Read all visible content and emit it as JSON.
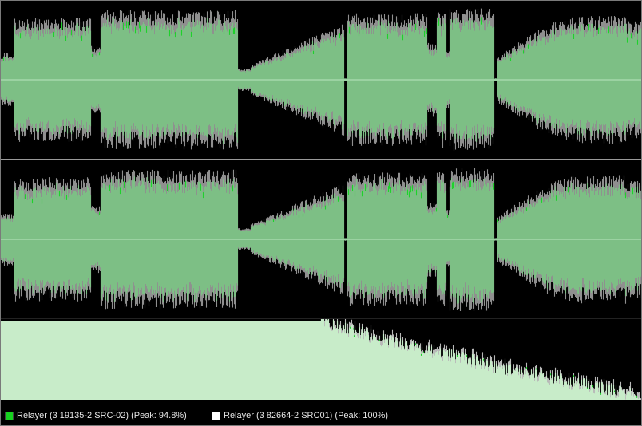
{
  "colors": {
    "background": "#000000",
    "wave_primary": "#7dbf85",
    "wave_secondary": "#8f8f8f",
    "wave_highlight": "#1fd12c",
    "center_line": "#b9e6bf",
    "spectrum_primary": "#c8ecc9",
    "spectrum_secondary": "#b8b8b8",
    "separator": "#9a9a9a"
  },
  "legend": {
    "items": [
      {
        "swatch_color": "#16d11f",
        "label": "Relayer (3 19135-2 SRC-02) (Peak: 94.8%)"
      },
      {
        "swatch_color": "#ffffff",
        "label": "Relayer (3 82664-2 SRC01) (Peak: 100%)"
      }
    ]
  },
  "waveform": {
    "envelope_levels": [
      {
        "from": 0.0,
        "to": 0.02,
        "level": 0.35
      },
      {
        "from": 0.02,
        "to": 0.14,
        "level": 0.82
      },
      {
        "from": 0.14,
        "to": 0.155,
        "level": 0.45
      },
      {
        "from": 0.155,
        "to": 0.37,
        "level": 0.92
      },
      {
        "from": 0.37,
        "to": 0.39,
        "level": 0.15
      },
      {
        "from": 0.39,
        "to": 0.535,
        "level": 0.55,
        "rising": true
      },
      {
        "from": 0.535,
        "to": 0.54,
        "level": 0.02
      },
      {
        "from": 0.54,
        "to": 0.665,
        "level": 0.88
      },
      {
        "from": 0.665,
        "to": 0.68,
        "level": 0.5
      },
      {
        "from": 0.68,
        "to": 0.695,
        "level": 0.9
      },
      {
        "from": 0.695,
        "to": 0.7,
        "level": 0.4
      },
      {
        "from": 0.7,
        "to": 0.77,
        "level": 0.95
      },
      {
        "from": 0.77,
        "to": 0.775,
        "level": 0.02
      },
      {
        "from": 0.775,
        "to": 1.0,
        "level": 0.85,
        "swell": true
      }
    ]
  },
  "spectrum": {
    "start_level": 0.98,
    "end_level": 0.03
  }
}
